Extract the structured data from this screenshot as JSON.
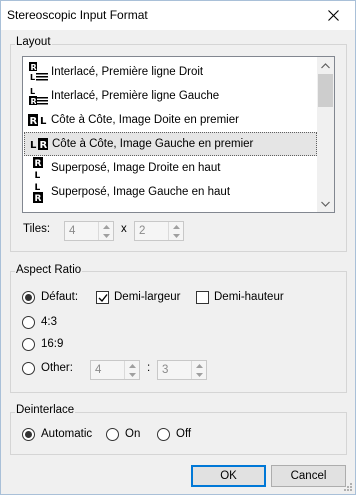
{
  "window": {
    "title": "Stereoscopic Input Format"
  },
  "layout": {
    "label": "Layout",
    "items": [
      {
        "label": "Interlacé, Première ligne Droit",
        "icon": "interlace-right-first-icon"
      },
      {
        "label": "Interlacé, Première ligne Gauche",
        "icon": "interlace-left-first-icon"
      },
      {
        "label": "Côte à Côte, Image Doite en premier",
        "icon": "side-by-side-right-first-icon"
      },
      {
        "label": "Côte à Côte, Image Gauche en premier",
        "icon": "side-by-side-left-first-icon"
      },
      {
        "label": "Superposé, Image Droite en haut",
        "icon": "top-bottom-right-top-icon"
      },
      {
        "label": "Superposé, Image Gauche en haut",
        "icon": "top-bottom-left-top-icon"
      }
    ],
    "selected_index": 3,
    "tiles_label": "Tiles:",
    "tiles_x": "4",
    "tiles_sep": "x",
    "tiles_y": "2"
  },
  "aspect": {
    "label": "Aspect Ratio",
    "default_label": "Défaut:",
    "half_width_label": "Demi-largeur",
    "half_height_label": "Demi-hauteur",
    "opt_43": "4:3",
    "opt_169": "16:9",
    "other_label": "Other:",
    "other_w": "4",
    "other_sep": ":",
    "other_h": "3"
  },
  "deinterlace": {
    "label": "Deinterlace",
    "automatic": "Automatic",
    "on": "On",
    "off": "Off"
  },
  "buttons": {
    "ok": "OK",
    "cancel": "Cancel"
  }
}
